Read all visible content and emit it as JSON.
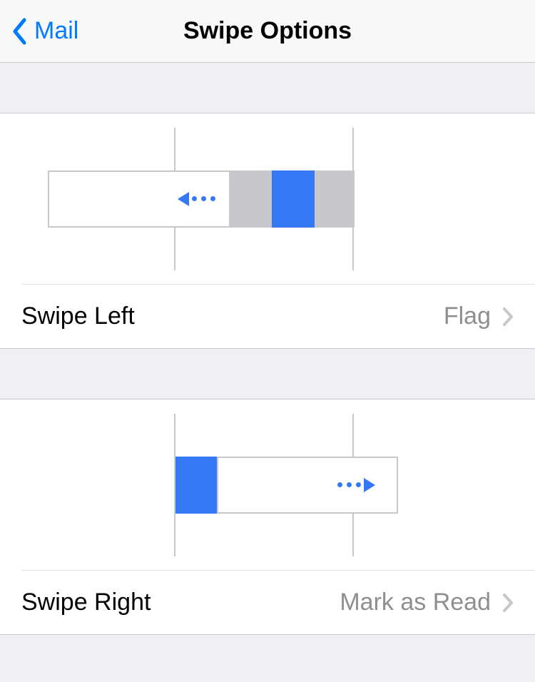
{
  "nav": {
    "back_label": "Mail",
    "title": "Swipe Options"
  },
  "swipe_left": {
    "label": "Swipe Left",
    "value": "Flag"
  },
  "swipe_right": {
    "label": "Swipe Right",
    "value": "Mark as Read"
  },
  "colors": {
    "accent": "#007aff",
    "action_blue": "#3478f6",
    "gray": "#c7c7cc"
  }
}
